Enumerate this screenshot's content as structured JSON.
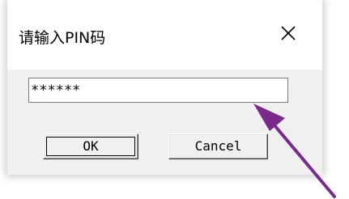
{
  "dialog": {
    "title": "请输入PIN码",
    "close_icon": "close-icon"
  },
  "pin_field": {
    "value": "******"
  },
  "buttons": {
    "ok_label": "OK",
    "cancel_label": "Cancel"
  },
  "annotation": {
    "arrow_color": "#7b2a8c",
    "icon": "pointer-arrow-icon"
  }
}
